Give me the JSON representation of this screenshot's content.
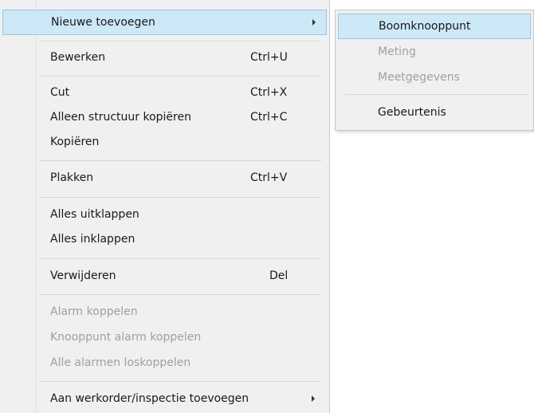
{
  "context_menu": {
    "items": [
      {
        "label": "Nieuwe toevoegen",
        "shortcut": "",
        "submenu": true,
        "disabled": false,
        "highlighted": true
      },
      {
        "label": "Bewerken",
        "shortcut": "Ctrl+U"
      },
      {
        "label": "Cut",
        "shortcut": "Ctrl+X"
      },
      {
        "label": "Alleen structuur kopiëren",
        "shortcut": "Ctrl+C"
      },
      {
        "label": "Kopiëren",
        "shortcut": ""
      },
      {
        "label": "Plakken",
        "shortcut": "Ctrl+V"
      },
      {
        "label": "Alles uitklappen",
        "shortcut": ""
      },
      {
        "label": "Alles inklappen",
        "shortcut": ""
      },
      {
        "label": "Verwijderen",
        "shortcut": "Del"
      },
      {
        "label": "Alarm koppelen",
        "shortcut": "",
        "disabled": true
      },
      {
        "label": "Knooppunt alarm koppelen",
        "shortcut": "",
        "disabled": true
      },
      {
        "label": "Alle alarmen loskoppelen",
        "shortcut": "",
        "disabled": true
      },
      {
        "label": "Aan werkorder/inspectie toevoegen",
        "shortcut": "",
        "submenu": true
      }
    ]
  },
  "submenu": {
    "items": [
      {
        "label": "Boomknooppunt",
        "highlighted": true
      },
      {
        "label": "Meting",
        "disabled": true
      },
      {
        "label": "Meetgegevens",
        "disabled": true
      },
      {
        "label": "Gebeurtenis"
      }
    ]
  },
  "colors": {
    "menu_background": "#f0f0f0",
    "highlight_background": "#cde8f7",
    "highlight_border": "#97c8e6",
    "disabled_text": "#a0a0a0"
  }
}
